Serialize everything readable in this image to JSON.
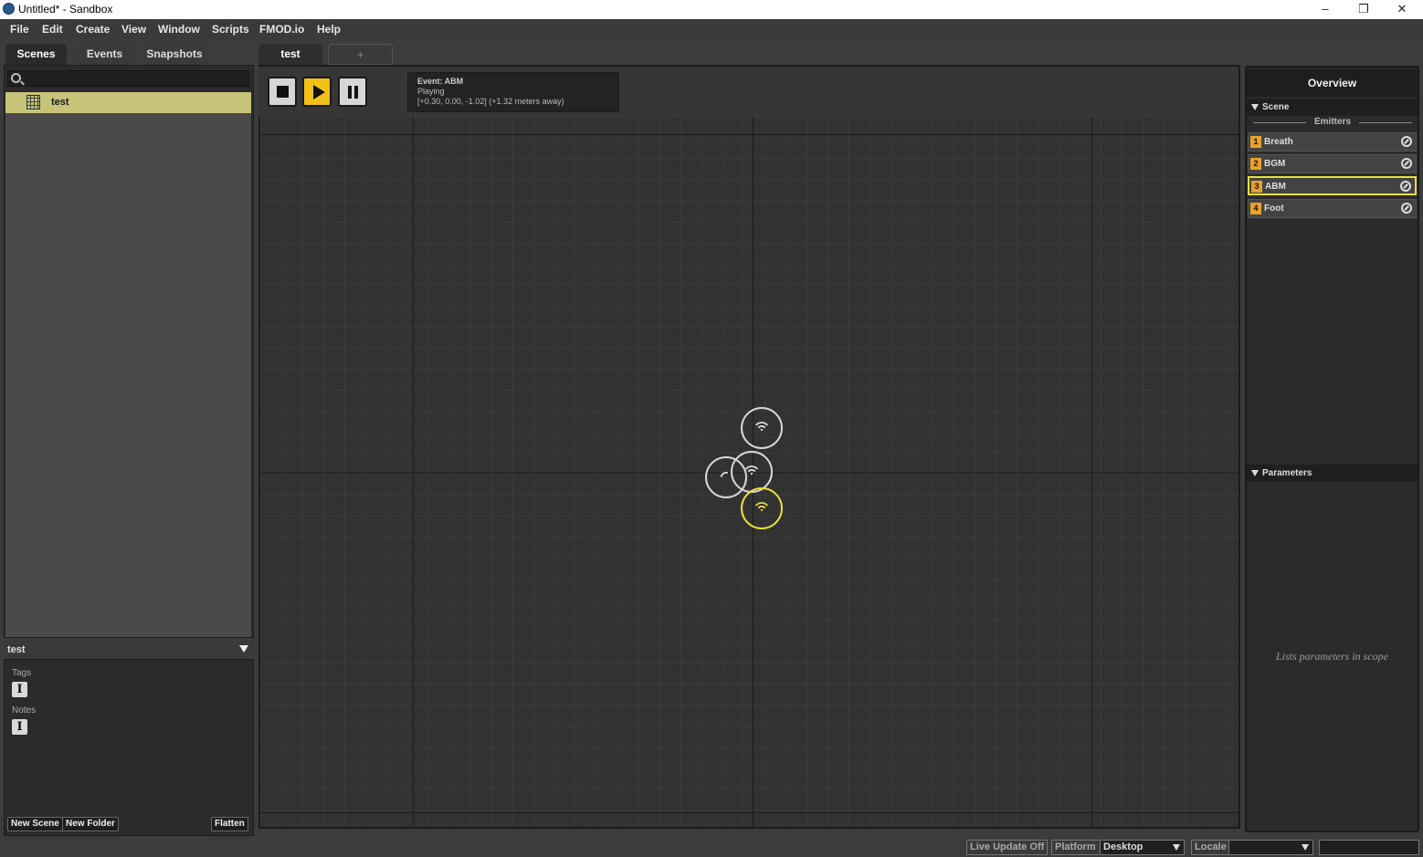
{
  "window": {
    "title": "Untitled* - Sandbox",
    "minimize_glyph": "–",
    "restore_glyph": "❐",
    "close_glyph": "✕"
  },
  "menu": {
    "items": [
      "File",
      "Edit",
      "Create",
      "View",
      "Window",
      "Scripts",
      "FMOD.io",
      "Help"
    ]
  },
  "left": {
    "tabs": [
      "Scenes",
      "Events",
      "Snapshots"
    ],
    "active_tab": "Scenes",
    "search_placeholder": "",
    "scene_item": "test",
    "detail": {
      "selected_name": "test",
      "tags_label": "Tags",
      "notes_label": "Notes",
      "text_glyph": "I"
    },
    "buttons": {
      "new_scene": "New Scene",
      "new_folder": "New Folder",
      "flatten": "Flatten"
    }
  },
  "center": {
    "tabs": [
      "test",
      "+"
    ],
    "active_tab": "test",
    "event_info": {
      "name": "Event: ABM",
      "state": "Playing",
      "position": "[+0.30, 0.00, -1.02] (+1.32 meters away)"
    },
    "emitter_icons": [
      "wifi-icon",
      "wifi-icon",
      "wifi-icon",
      "wifi-icon"
    ]
  },
  "right": {
    "title": "Overview",
    "scene_section": "Scene",
    "emitters_label": "Emitters",
    "emitters": [
      {
        "num": "1",
        "name": "Breath"
      },
      {
        "num": "2",
        "name": "BGM"
      },
      {
        "num": "3",
        "name": "ABM",
        "selected": true
      },
      {
        "num": "4",
        "name": "Foot"
      }
    ],
    "parameters_section": "Parameters",
    "parameters_empty": "Lists parameters in scope"
  },
  "status": {
    "live_update": "Live Update Off",
    "platform_label": "Platform",
    "platform_value": "Desktop",
    "locale_label": "Locale",
    "locale_value": ""
  },
  "colors": {
    "accent": "#f2c218",
    "selected_emitter": "#e8df3a",
    "scene_highlight": "#c7c47a"
  }
}
